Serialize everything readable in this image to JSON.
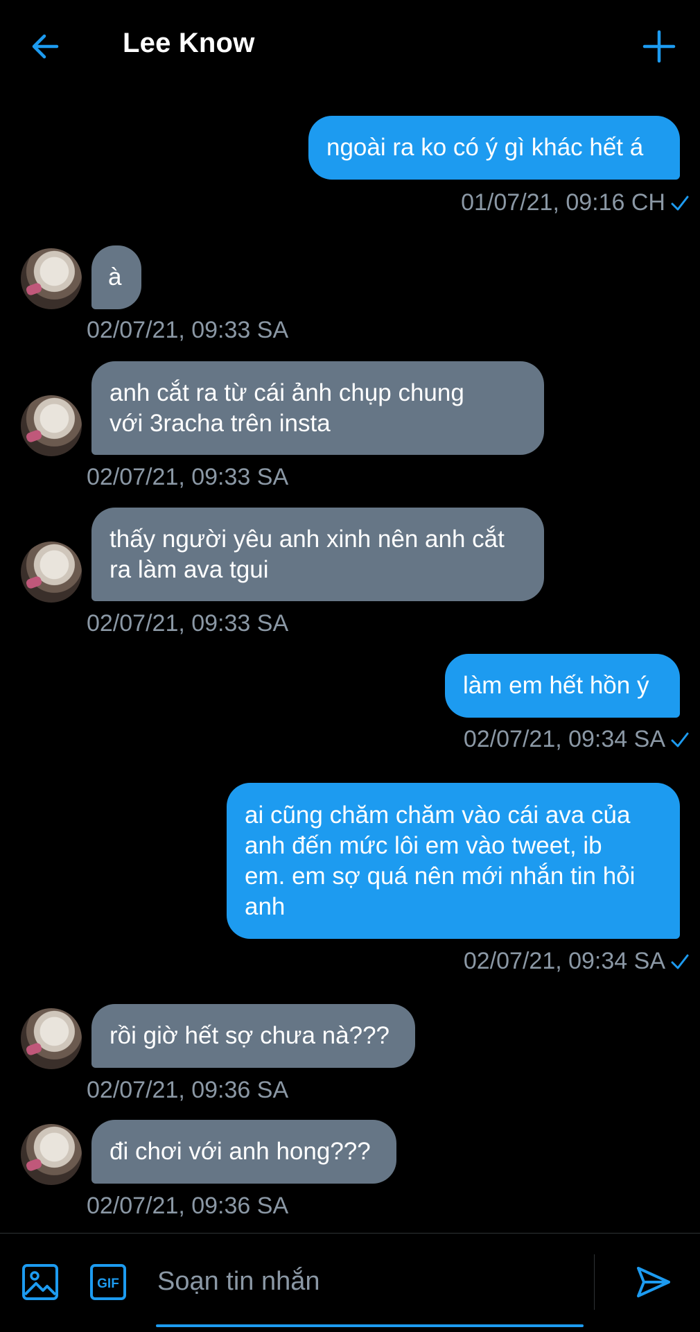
{
  "header": {
    "title": "Lee Know",
    "back_icon": "arrow-left-icon",
    "add_icon": "plus-icon"
  },
  "messages": [
    {
      "dir": "out",
      "text": "ngoài ra ko có ý gì khác hết á",
      "time": "01/07/21, 09:16 CH",
      "read": true
    },
    {
      "dir": "in",
      "text": "à",
      "time": "02/07/21, 09:33 SA"
    },
    {
      "dir": "in",
      "text": "anh cắt ra từ cái ảnh chụp chung\nvới 3racha trên insta",
      "time": "02/07/21, 09:33 SA"
    },
    {
      "dir": "in",
      "text": "thấy người yêu anh xinh nên anh cắt\nra làm ava tgui",
      "time": "02/07/21, 09:33 SA"
    },
    {
      "dir": "out",
      "text": "làm em hết hồn ý",
      "time": "02/07/21, 09:34 SA",
      "read": true
    },
    {
      "dir": "out",
      "text": "ai cũng chăm chăm vào cái ava của\nanh đến mức lôi em vào tweet, ib\nem. em sợ quá nên mới nhắn tin hỏi\nanh",
      "time": "02/07/21, 09:34 SA",
      "read": true
    },
    {
      "dir": "in",
      "text": "rồi giờ hết sợ chưa nà???",
      "time": "02/07/21, 09:36 SA"
    },
    {
      "dir": "in",
      "text": "đi chơi với anh hong???",
      "time": "02/07/21, 09:36 SA"
    }
  ],
  "composer": {
    "placeholder": "Soạn tin nhắn",
    "image_icon": "image-icon",
    "gif_label": "GIF",
    "send_icon": "send-icon"
  },
  "colors": {
    "accent": "#1d9bf0",
    "incoming_bubble": "#667686",
    "timestamp": "#8b98a5",
    "background": "#000000"
  }
}
